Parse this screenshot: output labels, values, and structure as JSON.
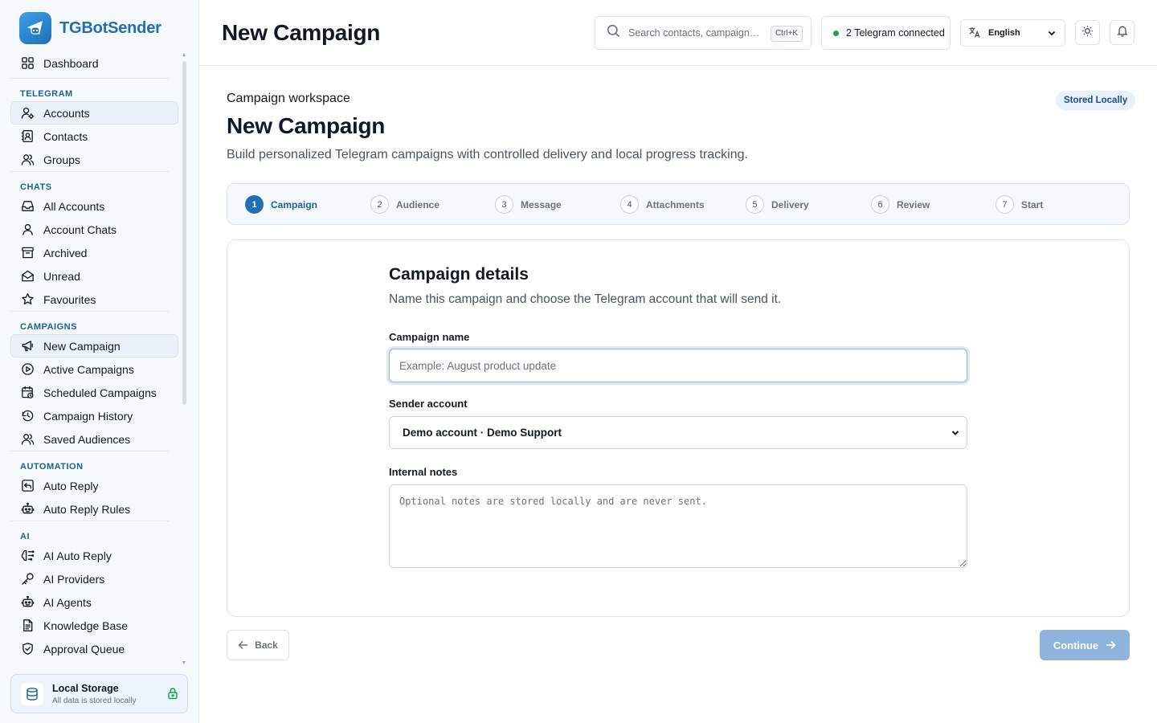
{
  "app": {
    "name": "TGBotSender",
    "logo_icon": "telegram-robot-icon",
    "accent_color": "#1f6fb5"
  },
  "sidebar": {
    "items": [
      {
        "type": "item",
        "label": "Dashboard",
        "icon": "dashboard-icon"
      },
      {
        "type": "section",
        "label": "TELEGRAM"
      },
      {
        "type": "item",
        "label": "Accounts",
        "icon": "user-gear-icon",
        "active": true
      },
      {
        "type": "item",
        "label": "Contacts",
        "icon": "contact-book-icon"
      },
      {
        "type": "item",
        "label": "Groups",
        "icon": "users-icon"
      },
      {
        "type": "section",
        "label": "CHATS"
      },
      {
        "type": "item",
        "label": "All Accounts",
        "icon": "inbox-icon"
      },
      {
        "type": "item",
        "label": "Account Chats",
        "icon": "user-icon"
      },
      {
        "type": "item",
        "label": "Archived",
        "icon": "archive-icon"
      },
      {
        "type": "item",
        "label": "Unread",
        "icon": "envelope-open-icon"
      },
      {
        "type": "item",
        "label": "Favourites",
        "icon": "star-icon"
      },
      {
        "type": "section",
        "label": "CAMPAIGNS"
      },
      {
        "type": "item",
        "label": "New Campaign",
        "icon": "megaphone-icon",
        "active": true
      },
      {
        "type": "item",
        "label": "Active Campaigns",
        "icon": "play-circle-icon"
      },
      {
        "type": "item",
        "label": "Scheduled Campaigns",
        "icon": "calendar-clock-icon"
      },
      {
        "type": "item",
        "label": "Campaign History",
        "icon": "history-icon"
      },
      {
        "type": "item",
        "label": "Saved Audiences",
        "icon": "users-icon"
      },
      {
        "type": "section",
        "label": "AUTOMATION"
      },
      {
        "type": "item",
        "label": "Auto Reply",
        "icon": "reply-icon"
      },
      {
        "type": "item",
        "label": "Auto Reply Rules",
        "icon": "bot-icon"
      },
      {
        "type": "section",
        "label": "AI"
      },
      {
        "type": "item",
        "label": "AI Auto Reply",
        "icon": "ai-brain-icon"
      },
      {
        "type": "item",
        "label": "AI Providers",
        "icon": "key-icon"
      },
      {
        "type": "item",
        "label": "AI Agents",
        "icon": "bot-icon"
      },
      {
        "type": "item",
        "label": "Knowledge Base",
        "icon": "document-icon"
      },
      {
        "type": "item",
        "label": "Approval Queue",
        "icon": "shield-check-icon"
      }
    ],
    "storage": {
      "title": "Local Storage",
      "subtitle": "All data is stored locally"
    }
  },
  "header": {
    "title": "New Campaign",
    "search_placeholder": "Search contacts, campaigns, t...",
    "search_shortcut": "Ctrl+K",
    "telegram_status": "2 Telegram connected",
    "status_color": "#16a34a",
    "language": "English"
  },
  "main": {
    "eyebrow": "Campaign workspace",
    "badge": "Stored Locally",
    "title": "New Campaign",
    "subtitle": "Build personalized Telegram campaigns with controlled delivery and local progress tracking.",
    "steps": [
      {
        "num": "1",
        "label": "Campaign",
        "active": true
      },
      {
        "num": "2",
        "label": "Audience"
      },
      {
        "num": "3",
        "label": "Message"
      },
      {
        "num": "4",
        "label": "Attachments"
      },
      {
        "num": "5",
        "label": "Delivery"
      },
      {
        "num": "6",
        "label": "Review"
      },
      {
        "num": "7",
        "label": "Start"
      }
    ],
    "form": {
      "title": "Campaign details",
      "subtitle": "Name this campaign and choose the Telegram account that will send it.",
      "name_label": "Campaign name",
      "name_placeholder": "Example: August product update",
      "name_value": "",
      "sender_label": "Sender account",
      "sender_value": "Demo account · Demo Support",
      "notes_label": "Internal notes",
      "notes_placeholder": "Optional notes are stored locally and are never sent."
    },
    "back_label": "Back",
    "continue_label": "Continue"
  }
}
